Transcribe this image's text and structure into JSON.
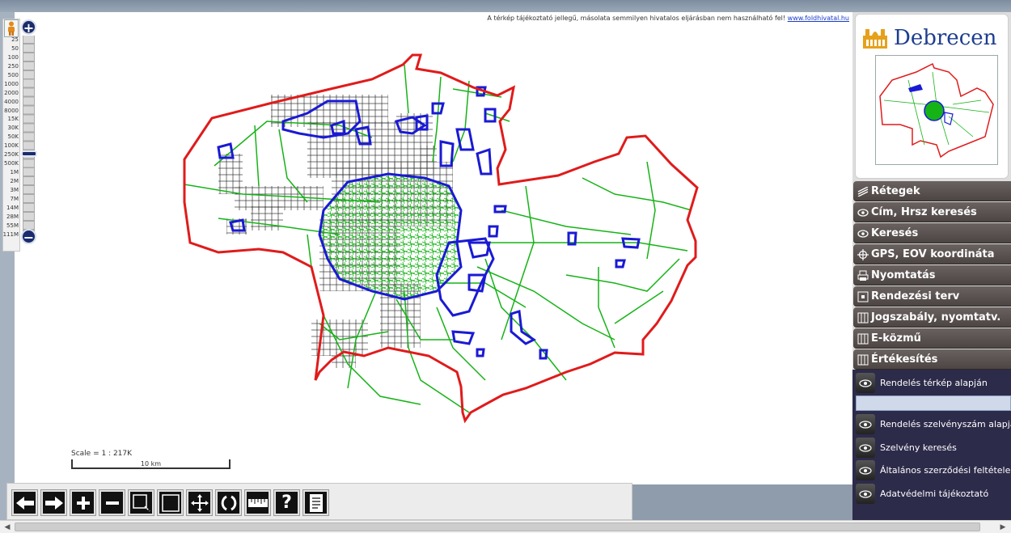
{
  "disclaimer": {
    "text": "A térkép tájékoztató jellegű, másolata semmilyen hivatalos eljárásban nem használható fel!",
    "link": "www.foldhivatal.hu"
  },
  "zoom": {
    "labels": [
      "25",
      "50",
      "100",
      "250",
      "500",
      "1000",
      "2000",
      "4000",
      "8000",
      "15K",
      "30K",
      "50K",
      "100K",
      "250K",
      "500K",
      "1M",
      "2M",
      "3M",
      "7M",
      "14M",
      "28M",
      "55M",
      "111M"
    ],
    "current": "250K",
    "in_label": "+",
    "out_label": "−"
  },
  "scale": {
    "text": "Scale = 1 : 217K",
    "bar_label": "10 km"
  },
  "logo": {
    "title": "Debrecen"
  },
  "menu": [
    {
      "label": "Rétegek",
      "icon": "layers-icon"
    },
    {
      "label": "Cím, Hrsz keresés",
      "icon": "eye-icon"
    },
    {
      "label": "Keresés",
      "icon": "eye-icon"
    },
    {
      "label": "GPS, EOV koordináta",
      "icon": "crosshair-icon"
    },
    {
      "label": "Nyomtatás",
      "icon": "printer-icon"
    },
    {
      "label": "Rendezési terv",
      "icon": "plan-icon"
    },
    {
      "label": "Jogszabály, nyomtatv.",
      "icon": "book-icon"
    },
    {
      "label": "E-közmű",
      "icon": "book-icon"
    },
    {
      "label": "Értékesítés",
      "icon": "book-icon"
    }
  ],
  "submenu": [
    {
      "label": "Rendelés térkép alapján",
      "icon": "eye-icon"
    },
    {
      "label": "Rendelés szelvényszám alapján",
      "icon": "eye-icon"
    },
    {
      "label": "Szelvény keresés",
      "icon": "eye-icon"
    },
    {
      "label": "Általános szerződési feltételek",
      "icon": "eye-icon"
    },
    {
      "label": "Adatvédelmi tájékoztató",
      "icon": "eye-icon"
    }
  ],
  "toolbar": [
    {
      "name": "pan-left-button",
      "icon": "arrow-left-icon"
    },
    {
      "name": "pan-right-button",
      "icon": "arrow-right-icon"
    },
    {
      "name": "zoom-in-button",
      "icon": "plus-icon"
    },
    {
      "name": "zoom-out-button",
      "icon": "minus-icon"
    },
    {
      "name": "zoom-box-button",
      "icon": "zoom-box-icon"
    },
    {
      "name": "full-extent-button",
      "icon": "square-icon"
    },
    {
      "name": "pan-button",
      "icon": "move-icon"
    },
    {
      "name": "refresh-button",
      "icon": "refresh-icon"
    },
    {
      "name": "measure-button",
      "icon": "ruler-icon"
    },
    {
      "name": "help-button",
      "icon": "question-icon"
    },
    {
      "name": "info-button",
      "icon": "document-icon"
    }
  ],
  "colors": {
    "boundary": "#e01b1b",
    "roads": "#16b316",
    "urban": "#1a1ad4",
    "grid": "#333333",
    "menu_bg": "#574f4d",
    "submenu_bg": "#2d2b4a"
  }
}
